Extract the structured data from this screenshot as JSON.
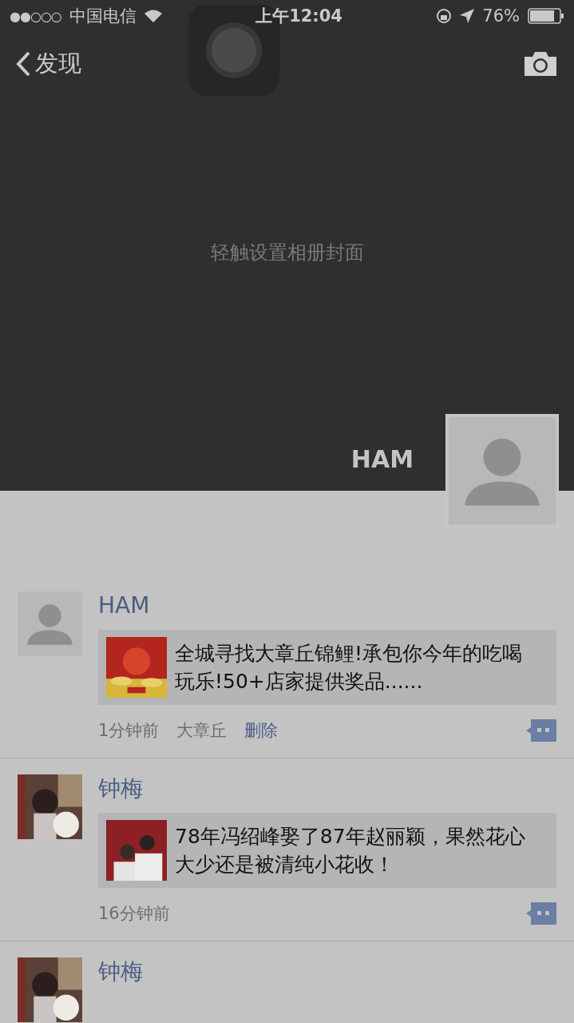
{
  "status_bar": {
    "signal_dots": "●●○○○",
    "carrier": "中国电信",
    "time": "上午12:04",
    "battery": "76%"
  },
  "nav": {
    "back_label": "发现"
  },
  "cover": {
    "hint": "轻触设置相册封面",
    "user_name": "HAM"
  },
  "posts": [
    {
      "name": "HAM",
      "link": {
        "text": "全城寻找大章丘锦鲤!承包你今年的吃喝玩乐!50+店家提供奖品......"
      },
      "time": "1分钟前",
      "location": "大章丘",
      "action": "删除"
    },
    {
      "name": "钟梅",
      "link": {
        "text": "78年冯绍峰娶了87年赵丽颖，果然花心大少还是被清纯小花收！"
      },
      "time": "16分钟前"
    },
    {
      "name": "钟梅"
    }
  ]
}
